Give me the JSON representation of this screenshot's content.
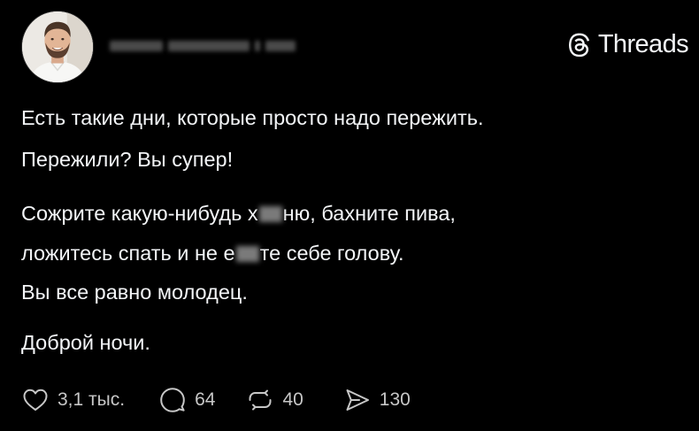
{
  "app": {
    "brand_name": "Threads",
    "brand_icon": "threads-logo-icon",
    "background_color": "#000000",
    "text_color": "#f3f5f7"
  },
  "author": {
    "avatar_icon": "avatar"
  },
  "post": {
    "line_1": "Есть такие дни, которые просто надо пережить.",
    "line_2": "Пережили? Вы супер!",
    "line_3a": "Сожрите какую-нибудь х",
    "line_3b": "ню, бахните пива,",
    "line_4a": "ложитесь спать и не е",
    "line_4b": "те себе голову.",
    "line_5": "Вы все равно молодец.",
    "line_6": "Доброй ночи."
  },
  "actions": {
    "likes": {
      "icon": "heart-icon",
      "count": "3,1 тыс."
    },
    "replies": {
      "icon": "comment-icon",
      "count": "64"
    },
    "reposts": {
      "icon": "repost-icon",
      "count": "40"
    },
    "shares": {
      "icon": "send-icon",
      "count": "130"
    }
  }
}
